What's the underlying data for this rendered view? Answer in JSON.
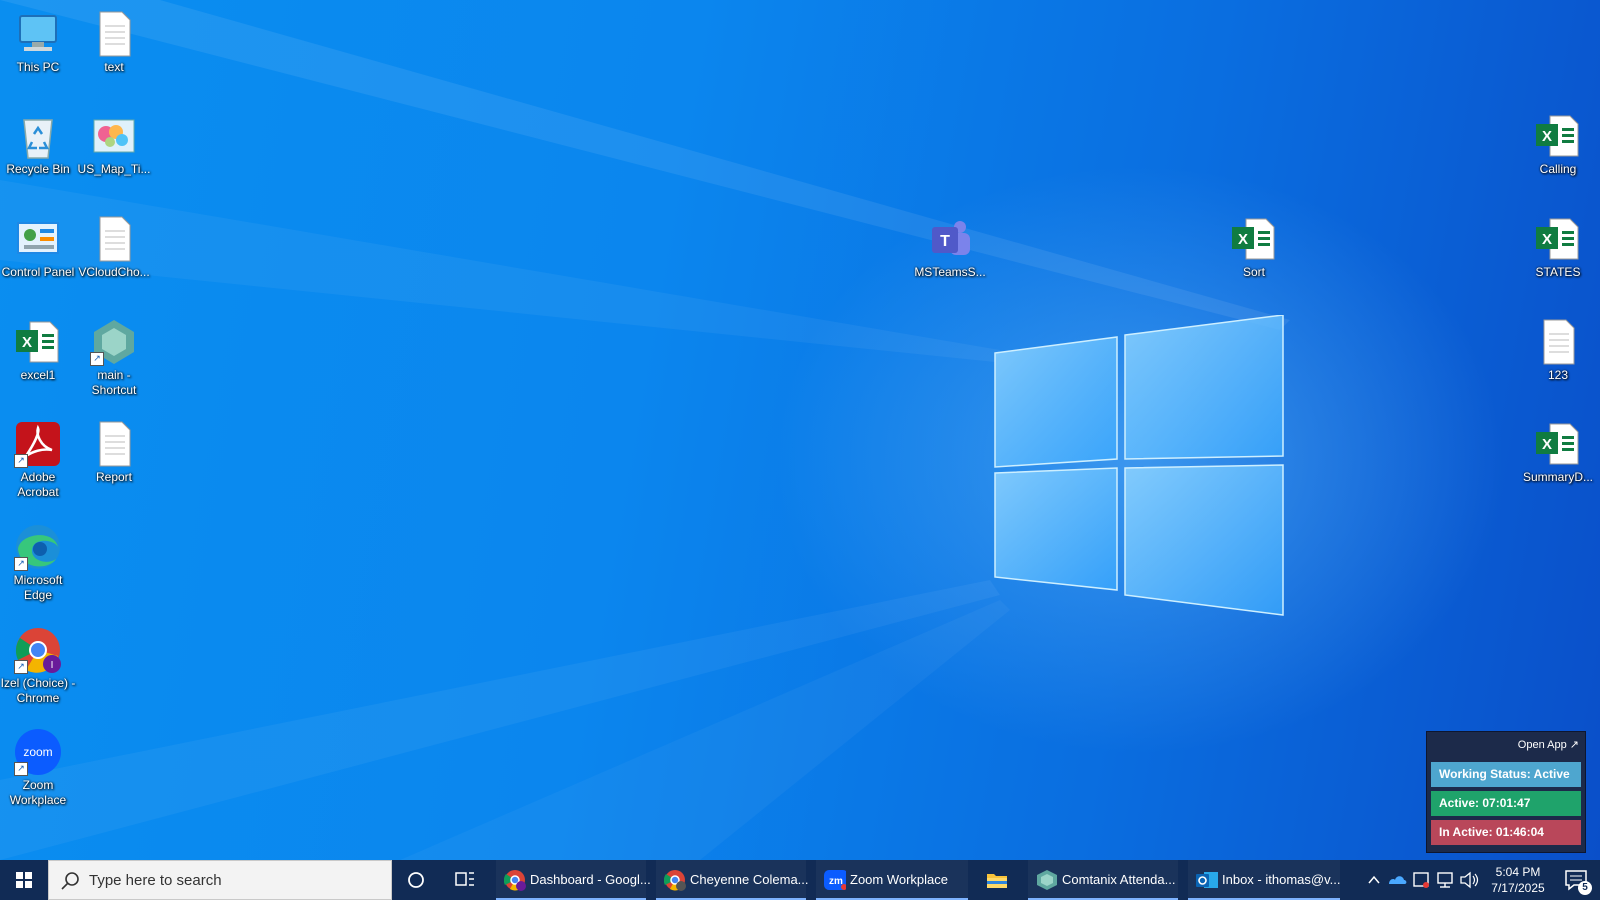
{
  "desktop": {
    "icons_left": [
      {
        "label": "This PC"
      },
      {
        "label": "text"
      },
      {
        "label": "Recycle Bin"
      },
      {
        "label": "US_Map_Ti..."
      },
      {
        "label": "Control Panel"
      },
      {
        "label": "VCloudCho..."
      },
      {
        "label": "excel1"
      },
      {
        "label": "main - Shortcut"
      },
      {
        "label": "Adobe Acrobat"
      },
      {
        "label": "Report"
      },
      {
        "label": "Microsoft Edge"
      },
      {
        "label": "Izel (Choice) - Chrome"
      },
      {
        "label": "Zoom Workplace"
      }
    ],
    "icons_other": [
      {
        "label": "MSTeamsS..."
      },
      {
        "label": "Sort"
      },
      {
        "label": "Calling"
      },
      {
        "label": "STATES"
      },
      {
        "label": "123"
      },
      {
        "label": "SummaryD..."
      }
    ]
  },
  "widget": {
    "open_app": "Open App ↗",
    "working_status": "Working Status: Active",
    "active": "Active: 07:01:47",
    "inactive": "In Active: 01:46:04",
    "colors": {
      "status": "#4ea6cf",
      "active": "#1fa36b",
      "inactive": "#b9475a"
    }
  },
  "taskbar": {
    "search_placeholder": "Type here to search",
    "tasks": [
      {
        "label": "Dashboard - Googl...",
        "icon": "chrome-icon"
      },
      {
        "label": "Cheyenne Colema...",
        "icon": "chrome-icon"
      },
      {
        "label": "Zoom Workplace",
        "icon": "zoom-icon"
      },
      {
        "label": "",
        "icon": "file-explorer-icon"
      },
      {
        "label": "Comtanix Attenda...",
        "icon": "comtanix-icon"
      },
      {
        "label": "Inbox - ithomas@v...",
        "icon": "outlook-icon"
      }
    ],
    "clock": {
      "time": "5:04 PM",
      "date": "7/17/2025"
    },
    "notification_count": "5"
  }
}
